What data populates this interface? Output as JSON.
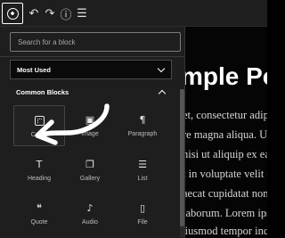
{
  "toolbar": {
    "inserter_icon": "plus-circle-icon",
    "undo_glyph": "↶",
    "redo_glyph": "↷",
    "info_glyph": "ⓘ",
    "list_view_glyph": "☰"
  },
  "inserter": {
    "search_placeholder": "Search for a block",
    "most_used_label": "Most Used",
    "category_label": "Common Blocks",
    "blocks": [
      {
        "label": "Cover",
        "icon": "cover-icon"
      },
      {
        "label": "Image",
        "icon": "image-icon",
        "glyph": "▣"
      },
      {
        "label": "Paragraph",
        "icon": "paragraph-icon",
        "glyph": "¶"
      },
      {
        "label": "Heading",
        "icon": "heading-icon",
        "glyph": "T"
      },
      {
        "label": "Gallery",
        "icon": "gallery-icon",
        "glyph": "❐"
      },
      {
        "label": "List",
        "icon": "list-icon",
        "glyph": "☰"
      },
      {
        "label": "Quote",
        "icon": "quote-icon",
        "glyph": "❝"
      },
      {
        "label": "Audio",
        "icon": "audio-icon",
        "glyph": "♪"
      },
      {
        "label": "File",
        "icon": "file-icon",
        "glyph": "▯"
      }
    ]
  },
  "editor": {
    "title_fragment": "mple Pos",
    "lines": [
      "et, consectetur adipi",
      "re magna aliqua. Ut",
      "nisi ut aliquip ex ea",
      "t in voluptate velit e",
      "aecat cupidatat non",
      "laborum. Lorem ips",
      "adipiscing elit, sed do eiusmod tempor incididu"
    ]
  },
  "colors": {
    "panel_bg": "#1e1e1e",
    "editor_bg": "#050505",
    "annotation_arrow": "#ffffff"
  }
}
